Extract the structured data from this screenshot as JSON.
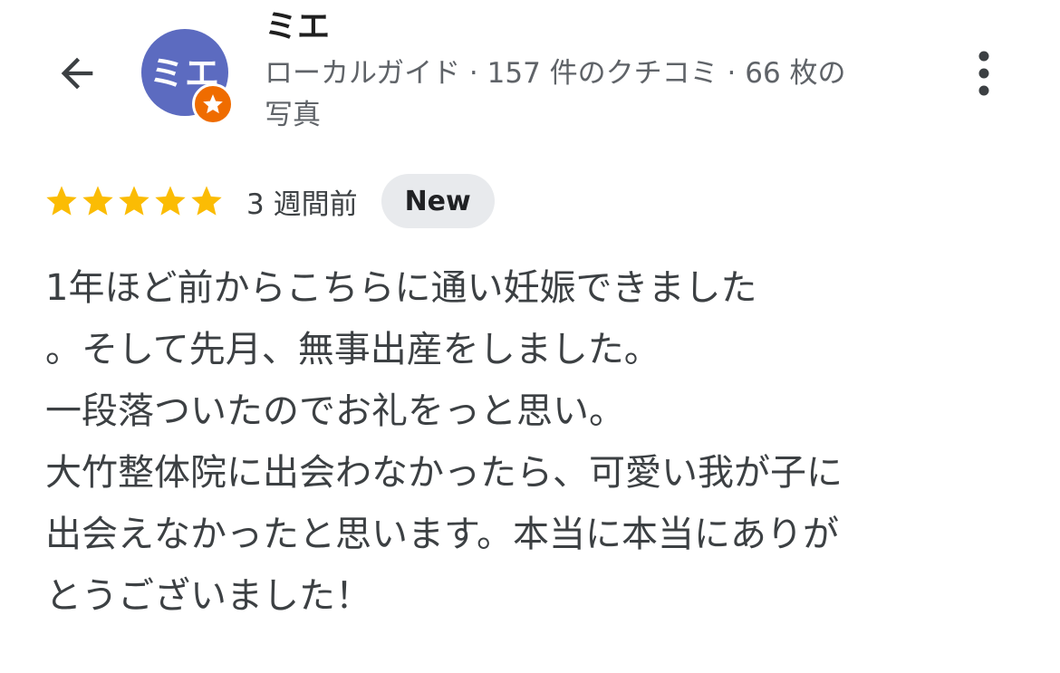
{
  "header": {
    "back_icon": "arrow-left-icon",
    "avatar_initials": "ミエ",
    "badge_icon": "local-guide-star-icon",
    "reviewer_name": "ミエ",
    "meta_line1": "ローカルガイド · 157 件のクチコミ · 66 枚の",
    "meta_line2": "写真",
    "menu_icon": "more-vert-icon"
  },
  "review": {
    "rating": 5,
    "max_rating": 5,
    "time": "3 週間前",
    "badge": "New",
    "lines": [
      "1年ほど前からこちらに通い妊娠できました",
      "。そして先月、無事出産をしました。",
      "一段落ついたのでお礼をっと思い。",
      "大竹整体院に出会わなかったら、可愛い我が子に",
      "出会えなかったと思います。本当に本当にありが",
      "とうございました！"
    ]
  },
  "colors": {
    "avatar": "#5c6bc0",
    "badge": "#ef6c00",
    "star": "#fbbc04",
    "new_badge_bg": "#e8eaed"
  }
}
